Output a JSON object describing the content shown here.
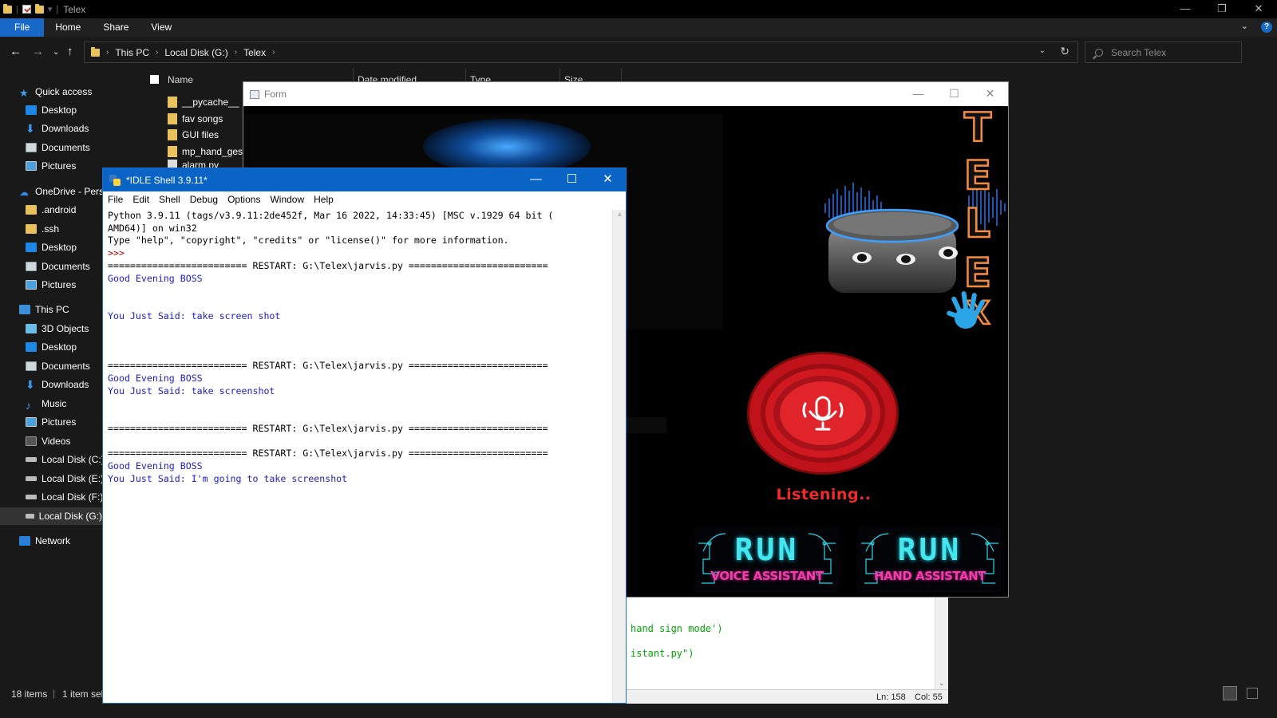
{
  "explorer": {
    "title": "Telex",
    "ribbon_tabs": [
      "File",
      "Home",
      "Share",
      "View"
    ],
    "breadcrumb": [
      "This PC",
      "Local Disk (G:)",
      "Telex"
    ],
    "search_placeholder": "Search Telex",
    "columns": [
      "Name",
      "Date modified",
      "Type",
      "Size"
    ],
    "files": [
      "__pycache__",
      "fav songs",
      "GUI files",
      "mp_hand_gest",
      "alarm.py"
    ],
    "nav": {
      "quick_access": "Quick access",
      "qa_items": [
        "Desktop",
        "Downloads",
        "Documents",
        "Pictures"
      ],
      "onedrive": "OneDrive - Perso",
      "od_items": [
        ".android",
        ".ssh",
        "Desktop",
        "Documents",
        "Pictures"
      ],
      "this_pc": "This PC",
      "pc_items": [
        "3D Objects",
        "Desktop",
        "Documents",
        "Downloads",
        "Music",
        "Pictures",
        "Videos",
        "Local Disk (C:)",
        "Local Disk (E:)",
        "Local Disk (F:)",
        "Local Disk (G:)"
      ],
      "network": "Network"
    },
    "status": {
      "items": "18 items",
      "selected": "1 item sel"
    }
  },
  "form": {
    "title": "Form",
    "telex_letters": [
      "T",
      "E",
      "L",
      "E",
      "X"
    ],
    "status_text": "Listening..",
    "run_word": "RUN",
    "voice_label": "VOICE ASSISTANT",
    "hand_label": "HAND ASSISTANT"
  },
  "editor": {
    "line1_a": "hand sign mode')",
    "line2_a": "istant.py\")",
    "ln": "Ln: 158",
    "col": "Col: 55"
  },
  "idle": {
    "title": "*IDLE Shell 3.9.11*",
    "menu": [
      "File",
      "Edit",
      "Shell",
      "Debug",
      "Options",
      "Window",
      "Help"
    ],
    "lines": [
      "Python 3.9.11 (tags/v3.9.11:2de452f, Mar 16 2022, 14:33:45) [MSC v.1929 64 bit (",
      "AMD64)] on win32",
      "Type \"help\", \"copyright\", \"credits\" or \"license()\" for more information.",
      ">>>",
      "========================= RESTART: G:\\Telex\\jarvis.py =========================",
      "Good Evening BOSS",
      "You Just Said: take screen shot",
      "========================= RESTART: G:\\Telex\\jarvis.py =========================",
      "Good Evening BOSS",
      "You Just Said: take screenshot",
      "========================= RESTART: G:\\Telex\\jarvis.py =========================",
      "========================= RESTART: G:\\Telex\\jarvis.py =========================",
      "Good Evening BOSS",
      "You Just Said: I'm going to take screenshot"
    ]
  },
  "colors": {
    "accent_blue": "#0a64c6",
    "idle_output": "#1c1cd8",
    "prompt_red": "#c00000",
    "telex_orange": "#f58a3c",
    "listen_red": "#f02b2b",
    "run_cyan": "#46e6ee",
    "run_pink": "#f23ca8"
  }
}
